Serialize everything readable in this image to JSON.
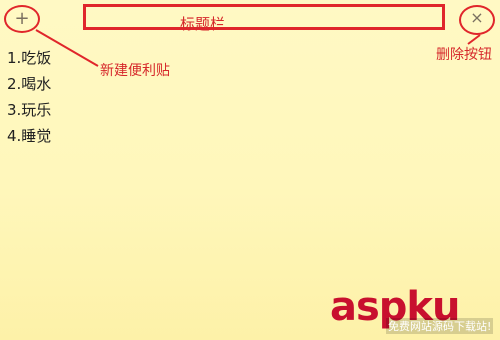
{
  "toolbar": {
    "new_icon": "+",
    "close_icon": "×"
  },
  "annotations": {
    "titlebar_label": "标题栏",
    "new_note_label": "新建便利贴",
    "delete_label": "删除按钮",
    "color": "#e0262b"
  },
  "notes": {
    "items": [
      "1.吃饭",
      "2.喝水",
      "3.玩乐",
      "4.睡觉"
    ]
  },
  "watermark": {
    "main": "aspku",
    "sub": "免费网站源码下载站!"
  }
}
